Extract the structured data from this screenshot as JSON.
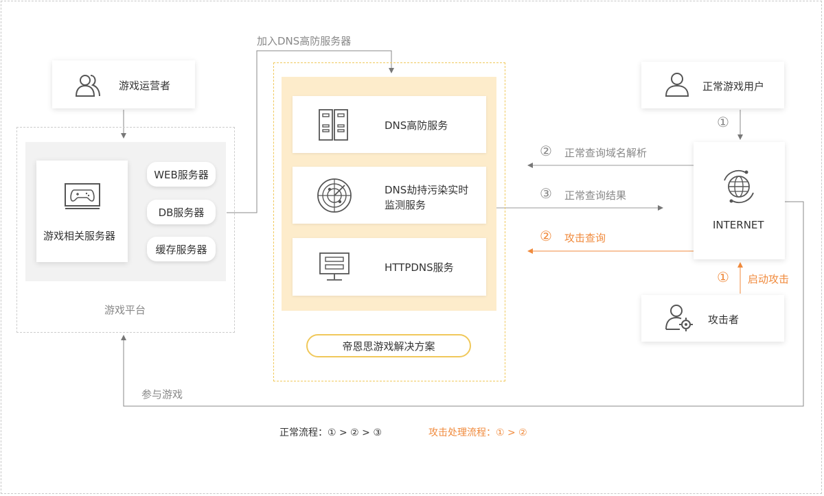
{
  "operator": {
    "label": "游戏运营者"
  },
  "platform": {
    "title": "游戏平台",
    "server_label": "游戏相关服务器",
    "pills": [
      "WEB服务器",
      "DB服务器",
      "缓存服务器"
    ]
  },
  "top_link": {
    "label": "加入DNS高防服务器"
  },
  "solution": {
    "title": "帝恩思游戏解决方案",
    "services": [
      "DNS高防服务",
      "DNS劫持污染实时",
      "监测服务",
      "HTTPDNS服务"
    ]
  },
  "user": {
    "label": "正常游戏用户"
  },
  "internet": {
    "label": "INTERNET"
  },
  "attacker": {
    "label": "攻击者"
  },
  "flows": {
    "step1_user": "①",
    "step2_num": "②",
    "step2_label": "正常查询域名解析",
    "step3_num": "③",
    "step3_label": "正常查询结果",
    "atk2_num": "②",
    "atk2_label": "攻击查询",
    "atk1_num": "①",
    "atk1_label": "启动攻击"
  },
  "bottom_link": {
    "label": "参与游戏"
  },
  "legend": {
    "normal": "正常流程：① > ② > ③",
    "attack": "攻击处理流程：① > ②"
  },
  "colors": {
    "accent": "#f08a3c",
    "highlight_bg": "#fdeccb",
    "gold_border": "#f0c85a",
    "line_gray": "#999999"
  }
}
